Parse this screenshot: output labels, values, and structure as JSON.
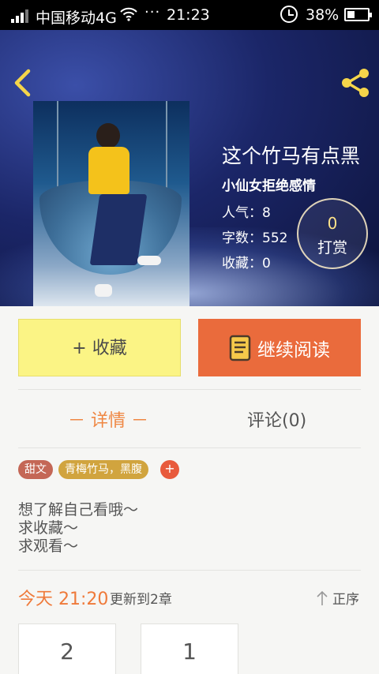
{
  "status_bar": {
    "carrier": "中国移动4G",
    "wifi_icon": "wifi-icon",
    "dots": "···",
    "time": "21:23",
    "battery_percent": "38%",
    "battery_level": 0.38
  },
  "header": {
    "back_icon": "chevron-left-icon",
    "share_icon": "share-icon",
    "accent_color": "#f5d54a"
  },
  "book": {
    "title": "这个竹马有点黑",
    "author": "小仙女拒绝感情",
    "popularity": "人气：8",
    "word_count": "字数：552",
    "favorites": "收藏：0",
    "reward_count": "0",
    "reward_label": "打赏"
  },
  "actions": {
    "favorite_label": "+ 收藏",
    "continue_label": "继续阅读"
  },
  "tabs": {
    "detail": "－ 详情 －",
    "comments": "评论(0)"
  },
  "tags": [
    "甜文",
    "青梅竹马，黑腹"
  ],
  "tag_add": "+",
  "description": [
    "想了解自己看哦～",
    "求收藏～",
    "求观看～"
  ],
  "update": {
    "day_time": "今天 21:20",
    "note": "更新到2章",
    "order_label": "正序"
  },
  "chapters": [
    "2",
    "1"
  ],
  "colors": {
    "orange": "#ea6b3c",
    "yellow_button": "#fbf485",
    "tab_active": "#ef8743"
  }
}
